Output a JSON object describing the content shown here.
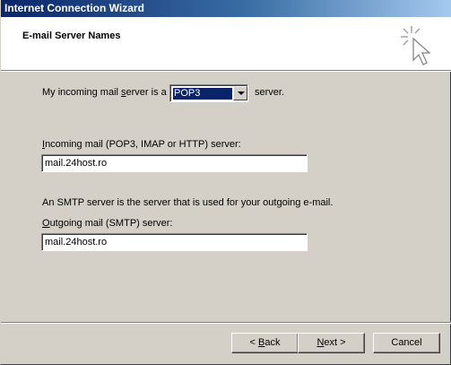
{
  "window": {
    "title": "Internet Connection Wizard"
  },
  "header": {
    "title": "E-mail Server Names",
    "icon": "wizard-wand-cursor-icon"
  },
  "form": {
    "incoming_type_prefix": "My incoming mail ",
    "incoming_type_underline": "s",
    "incoming_type_suffix": "erver is a",
    "server_type_value": "POP3",
    "server_type_after": "server.",
    "incoming_label_underline": "I",
    "incoming_label_rest": "ncoming mail (POP3, IMAP or HTTP) server:",
    "incoming_value": "mail.24host.ro",
    "smtp_note": "An SMTP server is the server that is used for your outgoing e-mail.",
    "outgoing_label_underline": "O",
    "outgoing_label_rest": "utgoing mail (SMTP) server:",
    "outgoing_value": "mail.24host.ro"
  },
  "buttons": {
    "back_prefix": "< ",
    "back_underline": "B",
    "back_rest": "ack",
    "next_underline": "N",
    "next_rest": "ext >",
    "cancel": "Cancel"
  }
}
